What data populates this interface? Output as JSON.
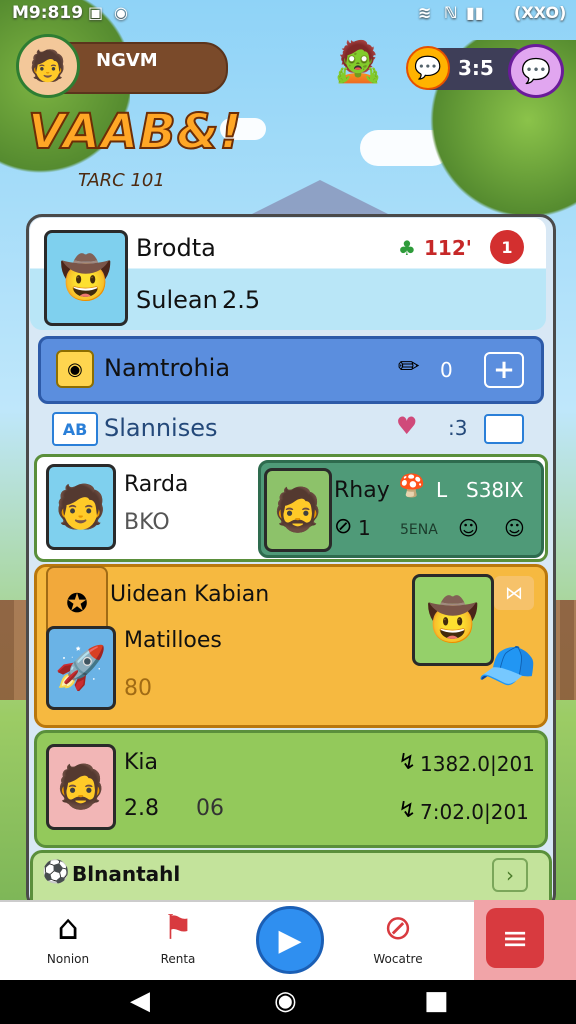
{
  "status_bar": {
    "time": "M9:819",
    "icons_left": [
      "gallery-icon",
      "shield-icon"
    ],
    "battery": "(XXO)"
  },
  "header": {
    "player_name": "NGVM",
    "coins": "3:5"
  },
  "logo": {
    "title": "VAAB&!",
    "subtitle": "TARC 101"
  },
  "card_top": {
    "name": "Brodta",
    "subtitle": "Sulean",
    "value": "2.5",
    "currency": "112'",
    "badge": "1"
  },
  "row_blue": {
    "label": "Namtrohia",
    "count": "0"
  },
  "row_2": {
    "badge": "AB",
    "label": "Slannises",
    "count": ":3"
  },
  "row_3": {
    "name": "Rarda",
    "code": "BKO",
    "right_title": "Rhay",
    "right_level": "L",
    "right_code": "S38IX",
    "right_count": "1",
    "right_footer": "5ENA"
  },
  "row_4": {
    "title": "Uidean Kabian",
    "subtitle": "Matilloes",
    "value": "80"
  },
  "row_5": {
    "name": "Kia",
    "stat_left": "2.8",
    "stat_left2": "06",
    "stat_right_1": "1382.0|201",
    "stat_right_2": "7:02.0|201"
  },
  "row_6": {
    "label": "Blnantahl"
  },
  "nav": {
    "items": [
      {
        "label": "Nonion"
      },
      {
        "label": "Renta"
      },
      {
        "label": "Wocatre"
      }
    ]
  },
  "colors": {
    "accent_blue": "#2f8ff0",
    "accent_red": "#d83a3f",
    "panel_orange": "#f6b940",
    "panel_green": "#93c95b"
  }
}
